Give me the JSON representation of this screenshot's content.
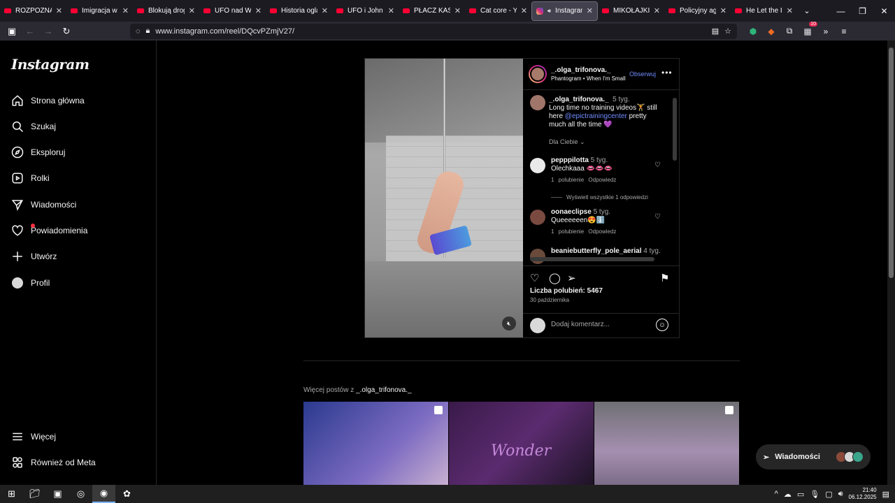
{
  "browser": {
    "tabs": [
      {
        "label": "ROZPOZNAJ KO",
        "type": "yt"
      },
      {
        "label": "Imigracja w Pols",
        "type": "yt"
      },
      {
        "label": "Blokują drogę, z",
        "type": "yt"
      },
      {
        "label": "UFO nad Waszy",
        "type": "yt"
      },
      {
        "label": "Historia oglądan",
        "type": "yt"
      },
      {
        "label": "UFO i John Kem",
        "type": "yt"
      },
      {
        "label": "PŁACZ KASIX! LI",
        "type": "yt"
      },
      {
        "label": "Cat core - YouTu",
        "type": "yt"
      },
      {
        "label": "Instagram",
        "type": "ig",
        "active": true
      },
      {
        "label": "MIKOŁAJKI Z KA",
        "type": "yt"
      },
      {
        "label": "Policyjny agreso",
        "type": "yt"
      },
      {
        "label": "He Let the Intru",
        "type": "yt"
      }
    ],
    "url": "www.instagram.com/reel/DQcvPZmjV27/"
  },
  "sidebar": {
    "logo": "Instagram",
    "items": [
      {
        "label": "Strona główna",
        "icon": "home-icon"
      },
      {
        "label": "Szukaj",
        "icon": "search-icon"
      },
      {
        "label": "Eksploruj",
        "icon": "compass-icon"
      },
      {
        "label": "Rolki",
        "icon": "reels-icon"
      },
      {
        "label": "Wiadomości",
        "icon": "send-icon"
      },
      {
        "label": "Powiadomienia",
        "icon": "heart-icon"
      },
      {
        "label": "Utwórz",
        "icon": "plus-icon"
      },
      {
        "label": "Profil",
        "icon": "avatar-icon"
      }
    ],
    "bottom": [
      {
        "label": "Więcej",
        "icon": "menu-icon"
      },
      {
        "label": "Również od Meta",
        "icon": "meta-icon"
      }
    ]
  },
  "post": {
    "author": "_.olga_trifonova._",
    "audio": "Phantogram • When I'm Small",
    "follow_label": "Obserwuj",
    "caption": {
      "user": "_.olga_trifonova._",
      "time": "5 tyg.",
      "text_before": "Long time no training videos🏋 still here ",
      "mention": "@epictrainingcenter",
      "text_after": " pretty much all the time 💜"
    },
    "dla_ciebie": "Dla Ciebie",
    "comments": [
      {
        "user": "pepppilotta",
        "time": "5 tyg.",
        "text": "Olechkaaa 👄👄👄",
        "likes": "1 polubienie",
        "reply": "Odpowiedz"
      },
      {
        "user": "oonaeclipse",
        "time": "5 tyg.",
        "text": "Queeeeeen😍ℹ️",
        "likes": "1 polubienie",
        "reply": "Odpowiedz"
      },
      {
        "user": "beaniebutterfly_pole_aerial",
        "time": "4 tyg.",
        "text": ""
      }
    ],
    "view_all_replies": "Wyświetl wszystkie 1 odpowiedzi",
    "likes_label": "Liczba polubień: 5467",
    "date": "30 października",
    "comment_placeholder": "Dodaj komentarz..."
  },
  "more_posts": {
    "prefix": "Więcej postów z ",
    "user": "_.olga_trifonova._",
    "neon_text": "Wonder"
  },
  "messages_pill": {
    "label": "Wiadomości"
  },
  "taskbar": {
    "time": "21:40",
    "date": "06.12.2025"
  },
  "colors": {
    "link": "#708dff",
    "background": "#000000",
    "border": "#262626"
  }
}
